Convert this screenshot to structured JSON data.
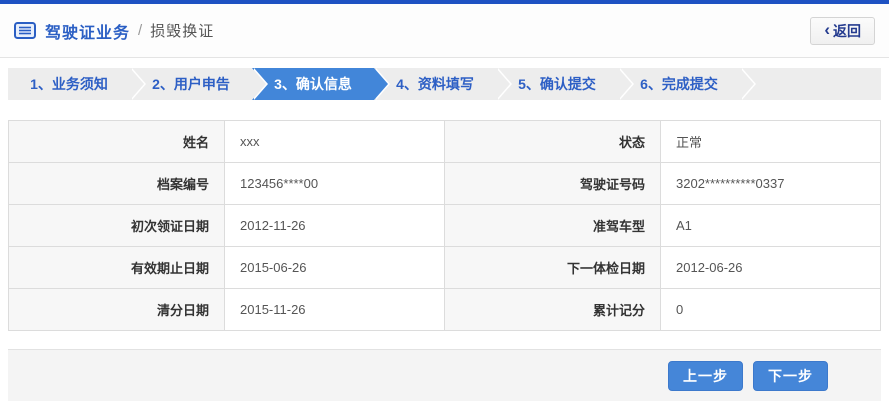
{
  "colors": {
    "brand_blue": "#1e52c3",
    "title_blue": "#2b5fc4",
    "step_text_blue": "#2d5fc5",
    "active_step_bg": "#4286d9",
    "button_bg": "#4586d8",
    "back_text_navy": "#243b8f",
    "label_cell_bg": "#f7f7f7",
    "band_bg": "#ededed"
  },
  "header": {
    "icon": "license-list-icon",
    "title": "驾驶证业务",
    "separator": "/",
    "subtitle": "损毁换证",
    "back_button": {
      "chevron": "‹",
      "label": "返回"
    }
  },
  "steps": {
    "active_label": "3、确认信息",
    "items": [
      {
        "label": "1、业务须知",
        "active": false
      },
      {
        "label": "2、用户申告",
        "active": false
      },
      {
        "label": "3、确认信息",
        "active": true
      },
      {
        "label": "4、资料填写",
        "active": false
      },
      {
        "label": "5、确认提交",
        "active": false
      },
      {
        "label": "6、完成提交",
        "active": false
      }
    ]
  },
  "info_table": {
    "rows": [
      {
        "label_left": "姓名",
        "value_left": "xxx",
        "label_right": "状态",
        "value_right": "正常"
      },
      {
        "label_left": "档案编号",
        "value_left": "123456****00",
        "label_right": "驾驶证号码",
        "value_right": "3202**********0337"
      },
      {
        "label_left": "初次领证日期",
        "value_left": "2012-11-26",
        "label_right": "准驾车型",
        "value_right": "A1"
      },
      {
        "label_left": "有效期止日期",
        "value_left": "2015-06-26",
        "label_right": "下一体检日期",
        "value_right": "2012-06-26"
      },
      {
        "label_left": "清分日期",
        "value_left": "2015-11-26",
        "label_right": "累计记分",
        "value_right": "0"
      }
    ]
  },
  "footer": {
    "prev_label": "上一步",
    "next_label": "下一步"
  }
}
